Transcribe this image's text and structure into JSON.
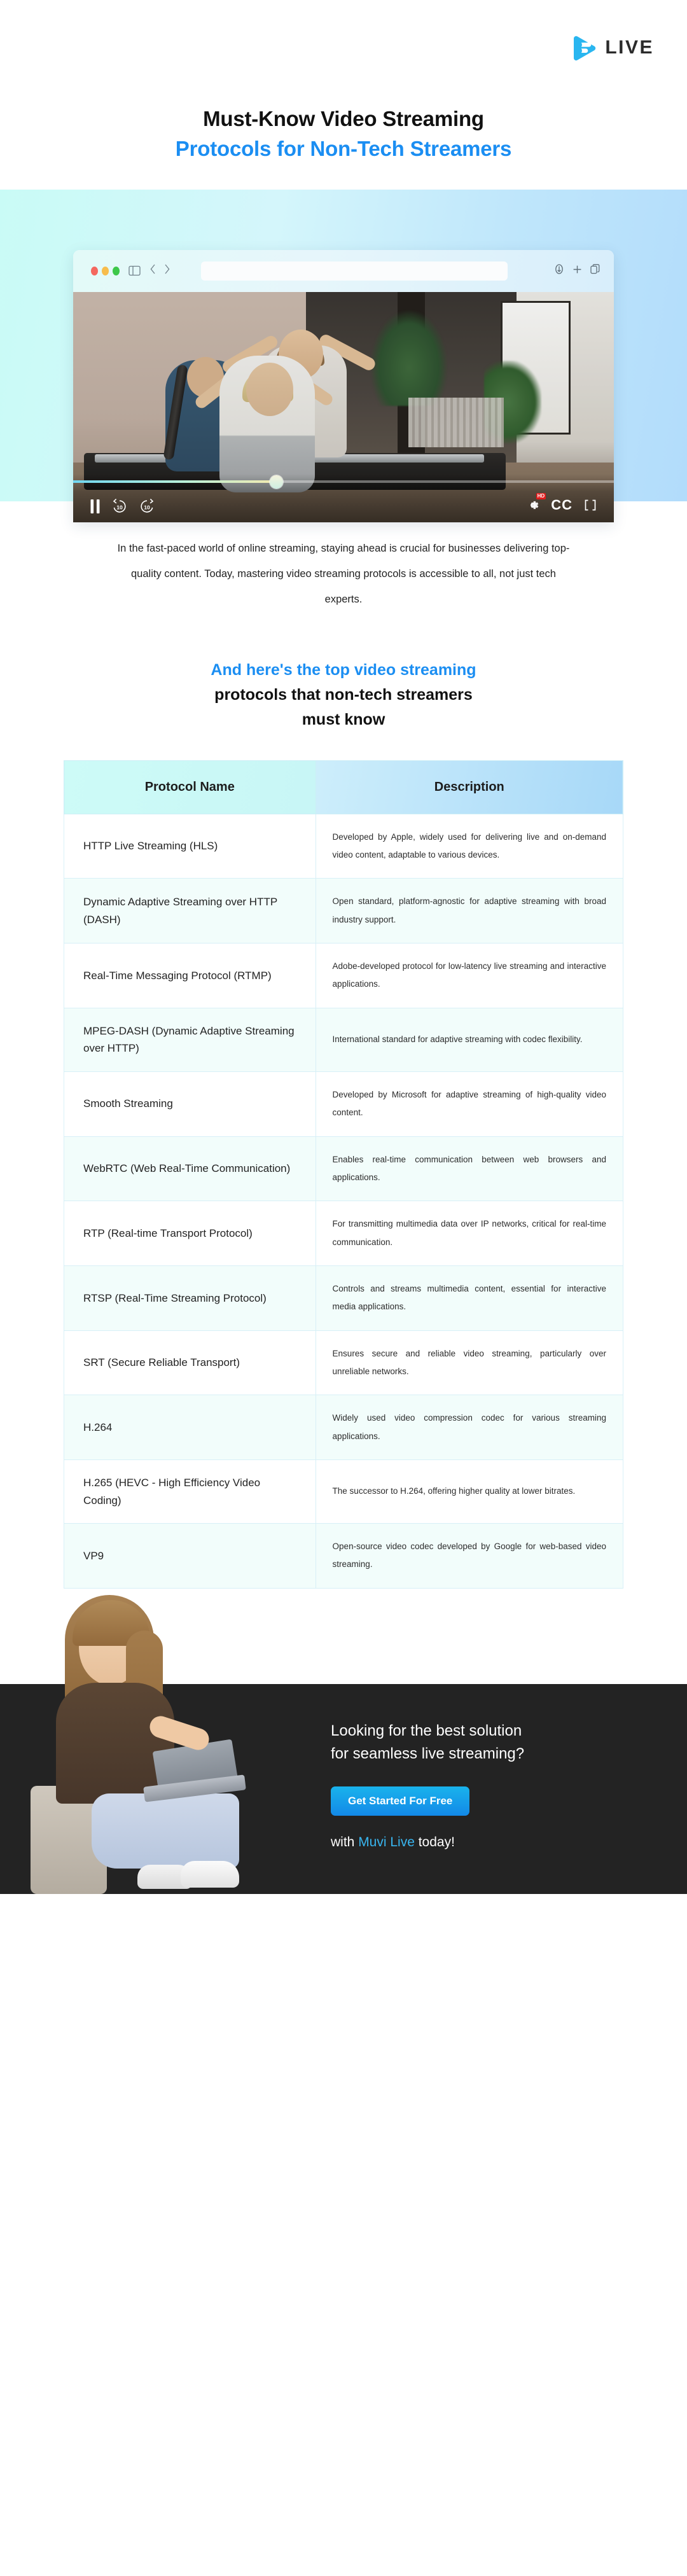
{
  "brand": {
    "logo_text": "LIVE",
    "logo_icon": "muvi-live-play-icon",
    "accent_color": "#1b8ef2",
    "logo_blue": "#29b6f0"
  },
  "title": {
    "line1": "Must-Know Video Streaming",
    "line2": "Protocols for Non-Tech Streamers"
  },
  "hero": {
    "browser": {
      "traffic_lights": [
        "red",
        "yellow",
        "green"
      ],
      "sidebar_icon": "sidebar-toggle-icon",
      "back_icon": "chevron-left-icon",
      "forward_icon": "chevron-right-icon",
      "url_value": "",
      "url_placeholder": "",
      "share_icon": "share-icon",
      "new_tab_icon": "plus-icon",
      "tabs_icon": "copy-tabs-icon"
    },
    "player": {
      "pause_icon": "pause-icon",
      "rewind_label": "10",
      "forward_label": "10",
      "rewind_icon": "rewind-10-icon",
      "forward_icon": "forward-10-icon",
      "settings_icon": "gear-icon",
      "quality_badge": "HD",
      "captions_label": "CC",
      "fullscreen_icon": "fullscreen-icon",
      "progress_percent": "37.5"
    }
  },
  "intro": {
    "paragraph": "In the fast-paced world of online streaming, staying ahead is crucial for businesses delivering top-quality content. Today, mastering video streaming protocols is accessible to all, not just tech experts."
  },
  "section_head": {
    "line1": "And here's the top video streaming",
    "line2": "protocols that non-tech streamers",
    "line3": "must know"
  },
  "table": {
    "columns": [
      "Protocol Name",
      "Description"
    ],
    "rows": [
      {
        "name": "HTTP Live Streaming (HLS)",
        "description": "Developed by Apple, widely used for delivering live and on-demand video content, adaptable to various devices."
      },
      {
        "name": "Dynamic Adaptive Streaming over HTTP (DASH)",
        "description": "Open standard, platform-agnostic for adaptive streaming with broad industry support."
      },
      {
        "name": "Real-Time Messaging Protocol (RTMP)",
        "description": "Adobe-developed protocol for low-latency live streaming and interactive applications."
      },
      {
        "name": "MPEG-DASH (Dynamic Adaptive Streaming over HTTP)",
        "description": "International standard for adaptive streaming with codec flexibility."
      },
      {
        "name": "Smooth Streaming",
        "description": "Developed by Microsoft for adaptive streaming of high-quality video content."
      },
      {
        "name": "WebRTC (Web Real-Time Communication)",
        "description": "Enables real-time communication between web browsers and applications."
      },
      {
        "name": "RTP (Real-time Transport Protocol)",
        "description": "For transmitting multimedia data over IP networks, critical for real-time communication."
      },
      {
        "name": "RTSP (Real-Time Streaming Protocol)",
        "description": "Controls and streams multimedia content, essential for interactive media applications."
      },
      {
        "name": "SRT (Secure Reliable Transport)",
        "description": "Ensures secure and reliable video streaming, particularly over unreliable networks."
      },
      {
        "name": "H.264",
        "description": "Widely used video compression codec for various streaming applications."
      },
      {
        "name": "H.265 (HEVC - High Efficiency Video Coding)",
        "description": "The successor to H.264, offering higher quality at lower bitrates."
      },
      {
        "name": "VP9",
        "description": "Open-source video codec developed by Google for web-based video streaming."
      }
    ]
  },
  "cta": {
    "heading_line1": "Looking for the best solution",
    "heading_line2": "for seamless live streaming?",
    "button_label": "Get Started For Free",
    "footer_prefix": "with ",
    "footer_link": "Muvi Live",
    "footer_suffix": " today!",
    "background_color": "#232323",
    "button_color": "#1389e8",
    "link_color": "#38b5ef"
  }
}
